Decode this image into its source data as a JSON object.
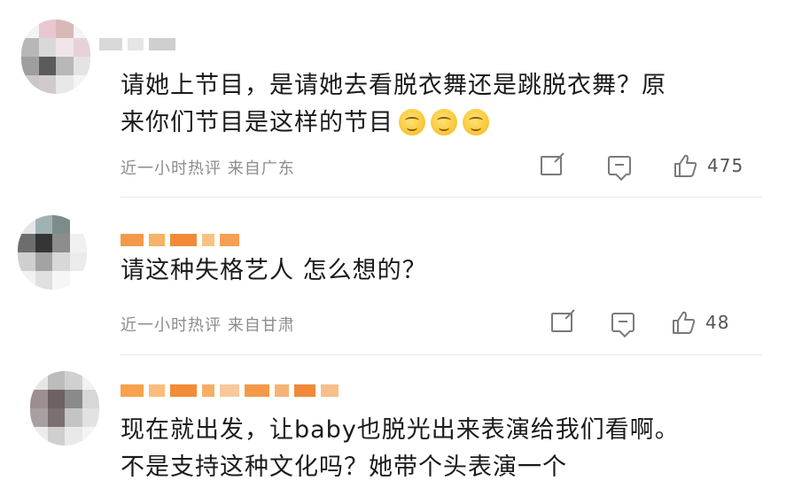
{
  "comments": [
    {
      "text_lines": [
        "请她上节目，是请她去看脱衣舞还是跳脱衣舞？原",
        "来你们节目是这样的节目"
      ],
      "emoji_count": 3,
      "emoji_name": "shy-grin-emoji",
      "meta": "近一小时热评  来自广东",
      "likes": "475",
      "avatar_colors": [
        "#f3f3f3",
        "#e8c7d1",
        "#d7b9b8",
        "#f4f4f4",
        "#b7b7b7",
        "#d9d9d9",
        "#f1e5e8",
        "#e7d3d6",
        "#9e9e9e",
        "#5b5b5b",
        "#b8b8b8",
        "#e4e4e4",
        "#c8c8c8",
        "#d4c9ca",
        "#e8e8e8",
        "#f5f5f5"
      ],
      "username_colors": [
        "#d9d9d9",
        "#e5e5e5",
        "#cfcfcf"
      ]
    },
    {
      "text_lines": [
        "请这种失格艺人 怎么想的？"
      ],
      "emoji_count": 0,
      "emoji_name": "",
      "meta": "近一小时热评  来自甘肃",
      "likes": "48",
      "avatar_colors": [
        "#e5e5e5",
        "#9fb3b5",
        "#7e8b8c",
        "#ffffff",
        "#6d6d6d",
        "#353535",
        "#8d8d8d",
        "#f0f0f0",
        "#cfcfcf",
        "#a3a3a3",
        "#d8d8d8",
        "#ebebeb",
        "#f2f2f2",
        "#e0e0e0",
        "#f6f6f6",
        "#ffffff"
      ],
      "username_colors": [
        "#f39a4a",
        "#f7b267",
        "#f28a39",
        "#f9c283",
        "#f5a052"
      ]
    },
    {
      "text_lines": [
        "现在就出发，让baby也脱光出来表演给我们看啊。",
        "不是支持这种文化吗？她带个头表演一个"
      ],
      "emoji_count": 0,
      "emoji_name": "",
      "meta": "",
      "likes": "",
      "avatar_colors": [
        "#e6e6e6",
        "#bcbcbc",
        "#d0d0d0",
        "#f2f2f2",
        "#9c8f90",
        "#6d6161",
        "#8a8a8a",
        "#d7d7d7",
        "#a8a0a0",
        "#7a7070",
        "#c4c4c4",
        "#e2e2e2",
        "#ececec",
        "#cfcfcf",
        "#e9e9e9",
        "#f4f4f4"
      ],
      "username_colors": [
        "#f7a24d",
        "#fbbd7c",
        "#f28c36",
        "#f5ae66",
        "#f9c89a",
        "#f39a48",
        "#f7b375",
        "#f08a3a",
        "#f6c08a"
      ]
    }
  ]
}
